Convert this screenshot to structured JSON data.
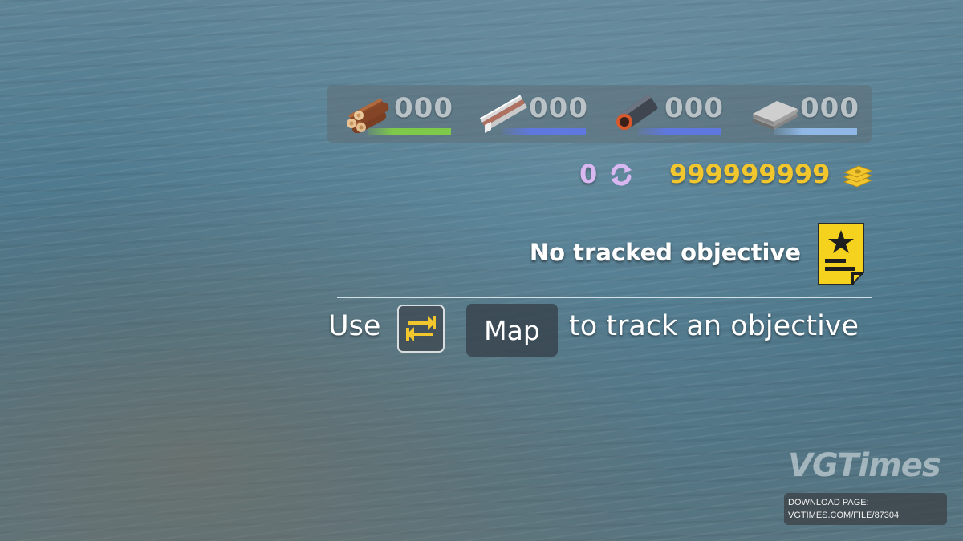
{
  "resources": [
    {
      "name": "wood-logs-icon",
      "count": "000",
      "bar_color": "#7ec84a"
    },
    {
      "name": "metal-beam-icon",
      "count": "000",
      "bar_color": "#5f78e0"
    },
    {
      "name": "pipe-icon",
      "count": "000",
      "bar_color": "#5f78e0"
    },
    {
      "name": "metal-sheets-icon",
      "count": "000",
      "bar_color": "#8fb8e6"
    }
  ],
  "currency": {
    "secondary_value": "0",
    "secondary_icon": "exchange-icon",
    "secondary_color": "#d9b8f2",
    "money_value": "999999999",
    "money_icon": "money-stack-icon",
    "money_color": "#f2c72e"
  },
  "objective": {
    "status": "No tracked objective",
    "icon": "objective-star-icon",
    "icon_color": "#f5d21e"
  },
  "hint": {
    "prefix": "Use",
    "swap_key_icon": "swap-arrows-icon",
    "map_key": "Map",
    "suffix": "to track an objective"
  },
  "watermark": {
    "logo": "VGTimes",
    "line1": "DOWNLOAD PAGE:",
    "line2": "VGTIMES.COM/FILE/87304"
  }
}
